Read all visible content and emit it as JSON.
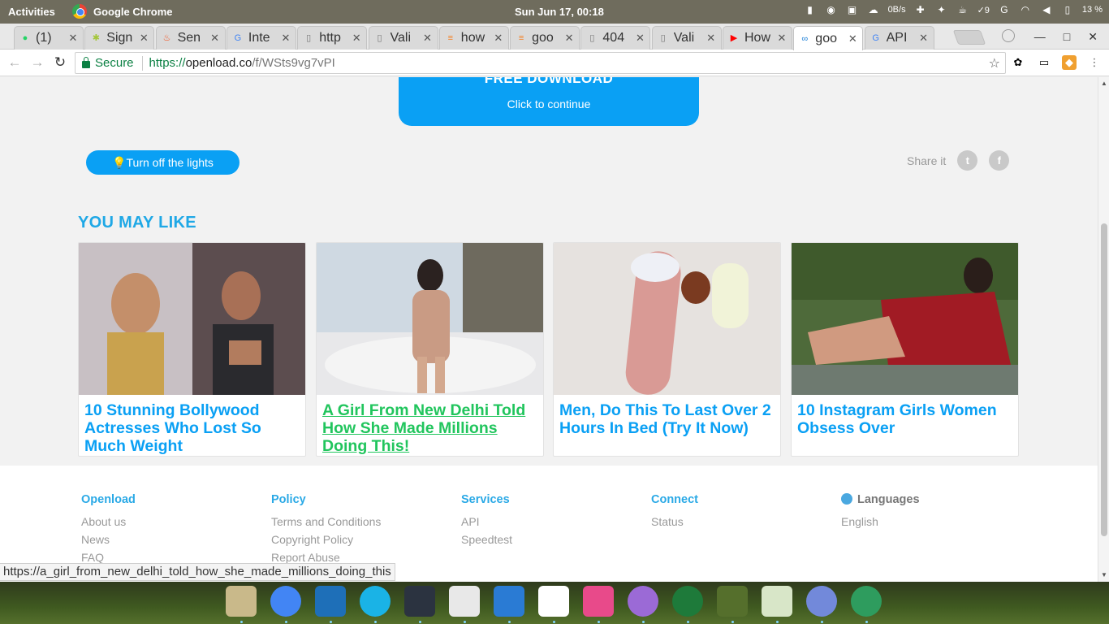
{
  "topbar": {
    "activities": "Activities",
    "app_name": "Google Chrome",
    "clock": "Sun Jun 17, 00:18",
    "net_speed": "0B/s",
    "notif_count": "9",
    "battery": "13 %"
  },
  "tabs": [
    {
      "title": "(1) ",
      "icon": "whatsapp-icon",
      "color": "#25d366"
    },
    {
      "title": "Sign",
      "icon": "android-icon",
      "color": "#a4c639"
    },
    {
      "title": "Sen",
      "icon": "flame-icon",
      "color": "#f4511e"
    },
    {
      "title": "Inte",
      "icon": "google-icon",
      "color": "#4285f4"
    },
    {
      "title": "http",
      "icon": "page-icon",
      "color": "#777777"
    },
    {
      "title": "Vali",
      "icon": "page-icon",
      "color": "#777777"
    },
    {
      "title": "how",
      "icon": "stackoverflow-icon",
      "color": "#f48024"
    },
    {
      "title": "goo",
      "icon": "stackoverflow-icon",
      "color": "#f48024"
    },
    {
      "title": "404",
      "icon": "page-icon",
      "color": "#777777"
    },
    {
      "title": "Vali",
      "icon": "page-icon",
      "color": "#777777"
    },
    {
      "title": "How",
      "icon": "youtube-icon",
      "color": "#ff0000"
    },
    {
      "title": "goo",
      "icon": "openload-icon",
      "color": "#1c7fd6",
      "active": true
    },
    {
      "title": "API",
      "icon": "google-icon",
      "color": "#4285f4"
    }
  ],
  "address": {
    "secure_label": "Secure",
    "protocol": "https://",
    "host": "openload.co",
    "path": "/f/WSts9vg7vPI"
  },
  "page": {
    "download_title": "FREE DOWNLOAD",
    "download_sub": "Click to continue",
    "lights_button": "Turn off the lights",
    "share_label": "Share it",
    "may_like": "YOU MAY LIKE",
    "cards": [
      {
        "title": "10 Stunning Bollywood Actresses Who Lost So Much Weight"
      },
      {
        "title": "A Girl From New Delhi Told How She Made Millions Doing This!"
      },
      {
        "title": "Men, Do This To Last Over 2 Hours In Bed (Try It Now)"
      },
      {
        "title": "10 Instagram Girls Women Obsess Over"
      }
    ]
  },
  "footer": {
    "openload": {
      "heading": "Openload",
      "links": [
        "About us",
        "News",
        "FAQ"
      ]
    },
    "policy": {
      "heading": "Policy",
      "links": [
        "Terms and Conditions",
        "Copyright Policy",
        "Report Abuse"
      ]
    },
    "services": {
      "heading": "Services",
      "links": [
        "API",
        "Speedtest"
      ]
    },
    "connect": {
      "heading": "Connect",
      "links": [
        "Status"
      ]
    },
    "languages": {
      "heading": "Languages",
      "links": [
        "English"
      ]
    }
  },
  "status_url": "https://a_girl_from_new_delhi_told_how_she_made_millions_doing_this",
  "dock": [
    {
      "name": "files-icon",
      "color": "#c9b98a"
    },
    {
      "name": "chrome-icon",
      "color": "#4285f4"
    },
    {
      "name": "notes-icon",
      "color": "#1e6fb8"
    },
    {
      "name": "mail-icon",
      "color": "#1ab3e6"
    },
    {
      "name": "terminal-icon",
      "color": "#2b3340"
    },
    {
      "name": "calendar-icon",
      "color": "#e8e8e8"
    },
    {
      "name": "screen-icon",
      "color": "#2a7bd4"
    },
    {
      "name": "typora-icon",
      "color": "#ffffff"
    },
    {
      "name": "gem-icon",
      "color": "#e84a8a"
    },
    {
      "name": "lines-icon",
      "color": "#9b6ad6"
    },
    {
      "name": "radar-icon",
      "color": "#1e7a3a"
    },
    {
      "name": "scissors-icon",
      "color": "#556f2c"
    },
    {
      "name": "trash-icon",
      "color": "#d8e6c8"
    },
    {
      "name": "discord-icon",
      "color": "#7289da"
    },
    {
      "name": "atom-icon",
      "color": "#2e9c5e"
    }
  ]
}
